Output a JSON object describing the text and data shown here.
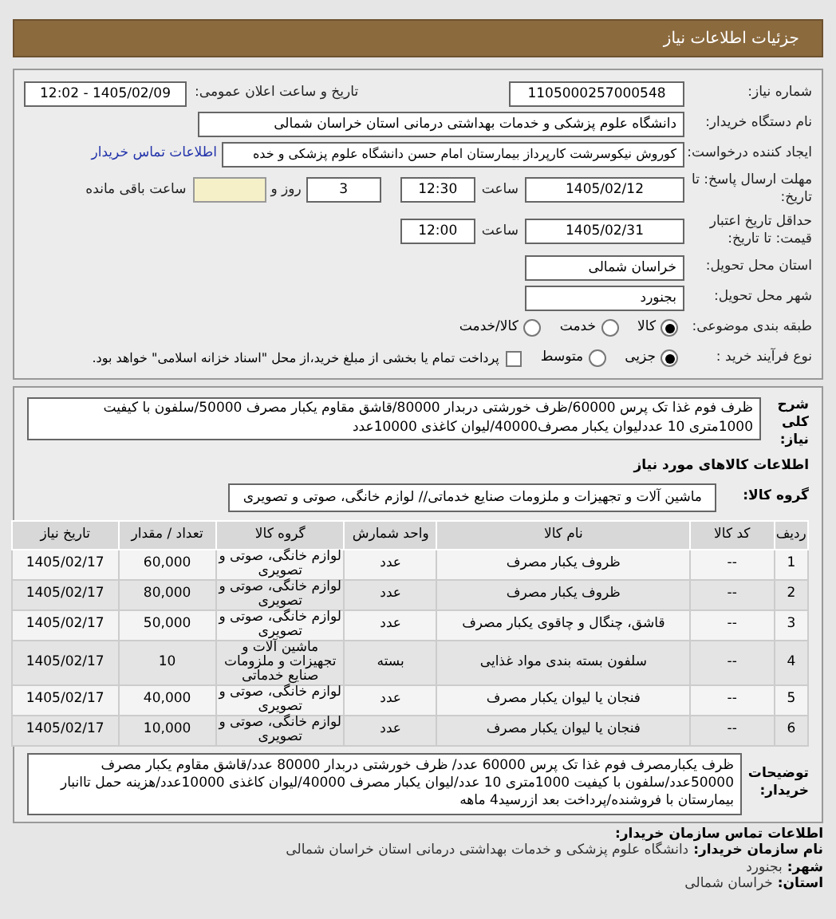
{
  "header": {
    "title": "جزئیات اطلاعات نیاز"
  },
  "form": {
    "need_number": {
      "label": "شماره نیاز:",
      "value": "1105000257000548"
    },
    "announce": {
      "label": "تاریخ و ساعت اعلان عمومی:",
      "value": "1405/02/09 - 12:02"
    },
    "buyer": {
      "label": "نام دستگاه خریدار:",
      "value": "دانشگاه علوم پزشکی و خدمات بهداشتی درمانی استان خراسان شمالی"
    },
    "creator": {
      "label": "ایجاد کننده درخواست:",
      "value": "کوروش نیکوسرشت کارپرداز بیمارستان امام حسن دانشگاه علوم پزشکی و خده",
      "link": "اطلاعات تماس خریدار"
    },
    "deadline": {
      "label": "مهلت ارسال پاسخ: تا تاریخ:",
      "date": "1405/02/12",
      "time_label": "ساعت",
      "time": "12:30",
      "days": "3",
      "days_label": "روز و",
      "remaining_label": "ساعت باقی مانده"
    },
    "validity": {
      "label": "حداقل تاریخ اعتبار قیمت: تا تاریخ:",
      "date": "1405/02/31",
      "time_label": "ساعت",
      "time": "12:00"
    },
    "province": {
      "label": "استان محل تحویل:",
      "value": "خراسان شمالی"
    },
    "city": {
      "label": "شهر محل تحویل:",
      "value": "بجنورد"
    },
    "category": {
      "label": "طبقه بندی موضوعی:",
      "options": [
        {
          "label": "کالا",
          "selected": true
        },
        {
          "label": "خدمت",
          "selected": false
        },
        {
          "label": "کالا/خدمت",
          "selected": false
        }
      ]
    },
    "process": {
      "label": "نوع فرآیند خرید :",
      "options": [
        {
          "label": "جزیی",
          "selected": true
        },
        {
          "label": "متوسط",
          "selected": false
        }
      ],
      "payment": {
        "label": "پرداخت تمام یا بخشی از مبلغ خرید،از محل \"اسناد خزانه اسلامی\" خواهد بود.",
        "checked": false
      }
    }
  },
  "description": {
    "label": "شرح کلی نیاز:",
    "value": "ظرف فوم غذا تک پرس 60000/ظرف خورشتی دربدار 80000/قاشق مقاوم یکبار مصرف 50000/سلفون با کیفیت 1000متری 10 عددلیوان یکبار مصرف40000/لیوان کاغذی 10000عدد"
  },
  "goods_title": "اطلاعات کالاهای مورد نیاز",
  "goods_group": {
    "label": "گروه کالا:",
    "value": "ماشین آلات و تجهیزات و ملزومات صنایع خدماتی// لوازم خانگی، صوتی و تصویری"
  },
  "table": {
    "columns": [
      "ردیف",
      "کد کالا",
      "نام کالا",
      "واحد شمارش",
      "گروه کالا",
      "تعداد / مقدار",
      "تاریخ نیاز"
    ],
    "rows": [
      [
        "1",
        "--",
        "ظروف یکبار مصرف",
        "عدد",
        "لوازم خانگی، صوتی و تصویری",
        "60,000",
        "1405/02/17"
      ],
      [
        "2",
        "--",
        "ظروف یکبار مصرف",
        "عدد",
        "لوازم خانگی، صوتی و تصویری",
        "80,000",
        "1405/02/17"
      ],
      [
        "3",
        "--",
        "قاشق، چنگال و چاقوی یکبار مصرف",
        "عدد",
        "لوازم خانگی، صوتی و تصویری",
        "50,000",
        "1405/02/17"
      ],
      [
        "4",
        "--",
        "سلفون بسته بندی مواد غذایی",
        "بسته",
        "ماشین آلات و تجهیزات و ملزومات صنایع خدماتی",
        "10",
        "1405/02/17"
      ],
      [
        "5",
        "--",
        "فنجان یا لیوان یکبار مصرف",
        "عدد",
        "لوازم خانگی، صوتی و تصویری",
        "40,000",
        "1405/02/17"
      ],
      [
        "6",
        "--",
        "فنجان یا لیوان یکبار مصرف",
        "عدد",
        "لوازم خانگی، صوتی و تصویری",
        "10,000",
        "1405/02/17"
      ]
    ]
  },
  "buyer_notes": {
    "label": "توضیحات خریدار:",
    "value": "ظرف یکبارمصرف فوم غذا تک پرس 60000 عدد/ ظرف خورشتی دربدار 80000 عدد/قاشق مقاوم یکبار مصرف 50000عدد/سلفون با کیفیت 1000متری 10 عدد/لیوان یکبار مصرف 40000/لیوان کاغذی 10000عدد/هزینه حمل تاانبار بیمارستان با فروشنده/پرداخت بعد ازرسید4 ماهه"
  },
  "contact": {
    "title": "اطلاعات تماس سازمان خریدار:",
    "fields": [
      {
        "label": "نام سازمان خریدار:",
        "value": "دانشگاه علوم پزشکی و خدمات بهداشتی درمانی استان خراسان شمالی"
      },
      {
        "label": "شهر:",
        "value": "بجنورد"
      },
      {
        "label": "استان:",
        "value": "خراسان شمالی"
      }
    ]
  }
}
